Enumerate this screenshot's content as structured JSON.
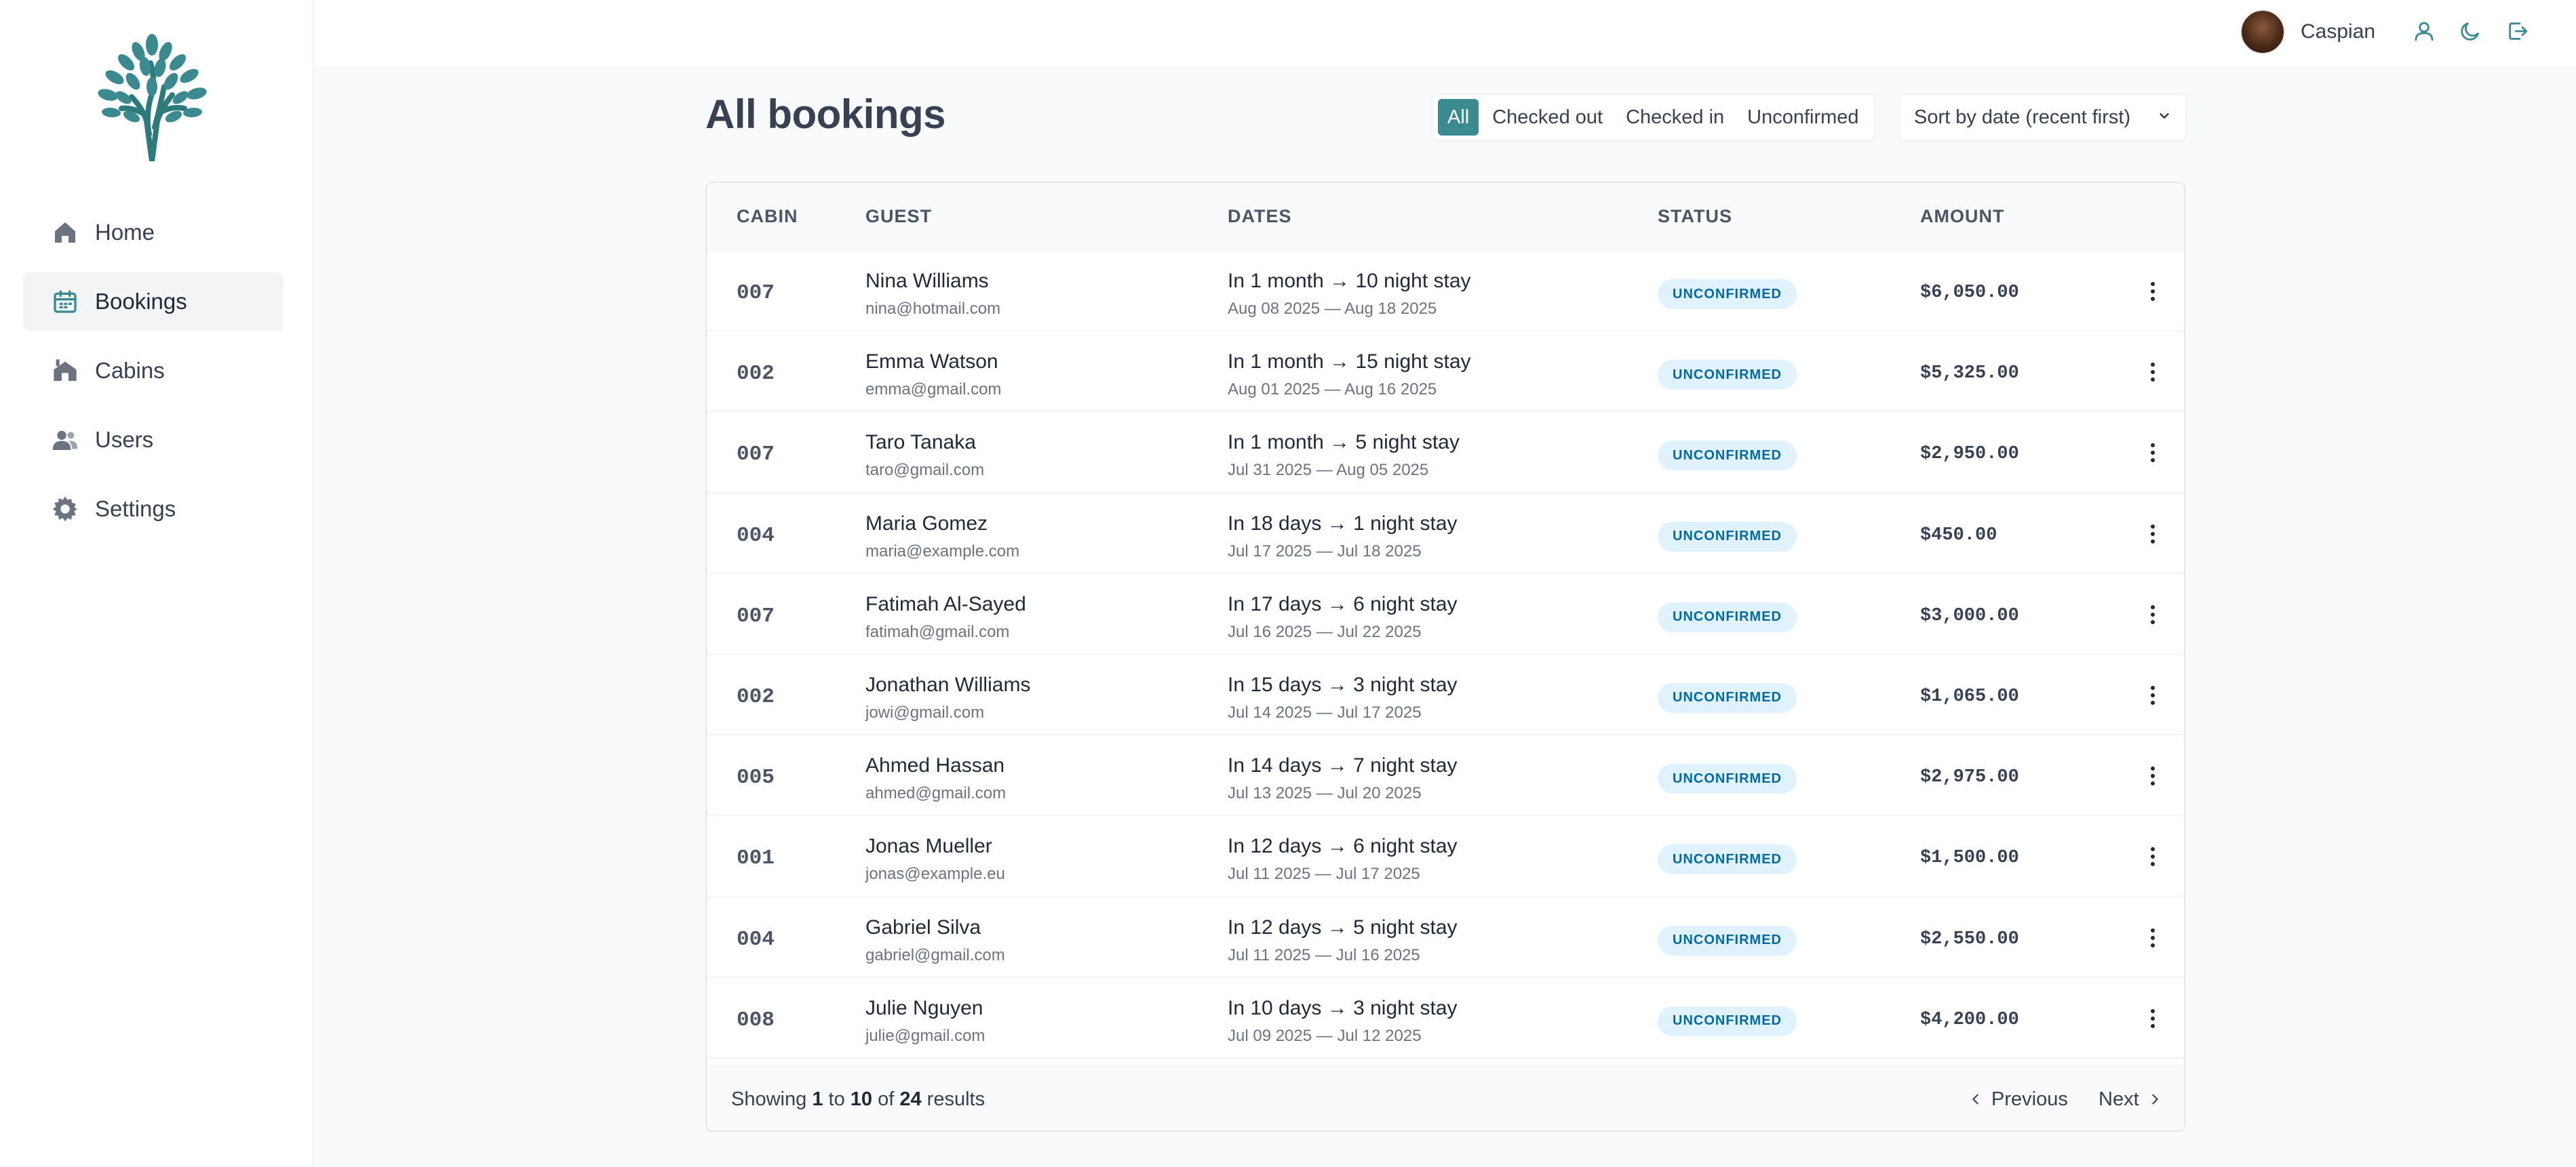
{
  "colors": {
    "brand": "#3b8a8f",
    "badge_bg": "#e0f2fe",
    "badge_text": "#0369a1"
  },
  "sidebar": {
    "logo": "tree-logo",
    "items": [
      {
        "label": "Home",
        "icon": "home-icon",
        "active": false
      },
      {
        "label": "Bookings",
        "icon": "calendar-icon",
        "active": true
      },
      {
        "label": "Cabins",
        "icon": "cabin-icon",
        "active": false
      },
      {
        "label": "Users",
        "icon": "users-icon",
        "active": false
      },
      {
        "label": "Settings",
        "icon": "gear-icon",
        "active": false
      }
    ]
  },
  "header": {
    "user_name": "Caspian",
    "buttons": [
      "user-icon",
      "moon-icon",
      "logout-icon"
    ]
  },
  "page": {
    "title": "All bookings"
  },
  "filter": {
    "options": [
      "All",
      "Checked out",
      "Checked in",
      "Unconfirmed"
    ],
    "selected": "All"
  },
  "sort": {
    "selected": "Sort by date (recent first)"
  },
  "table": {
    "columns": [
      "CABIN",
      "GUEST",
      "DATES",
      "STATUS",
      "AMOUNT"
    ],
    "rows": [
      {
        "cabin": "007",
        "guest": "Nina Williams",
        "email": "nina@hotmail.com",
        "stay": "In 1 month → 10 night stay",
        "range": "Aug 08 2025 — Aug 18 2025",
        "status": "UNCONFIRMED",
        "amount": "$6,050.00"
      },
      {
        "cabin": "002",
        "guest": "Emma Watson",
        "email": "emma@gmail.com",
        "stay": "In 1 month → 15 night stay",
        "range": "Aug 01 2025 — Aug 16 2025",
        "status": "UNCONFIRMED",
        "amount": "$5,325.00"
      },
      {
        "cabin": "007",
        "guest": "Taro Tanaka",
        "email": "taro@gmail.com",
        "stay": "In 1 month → 5 night stay",
        "range": "Jul 31 2025 — Aug 05 2025",
        "status": "UNCONFIRMED",
        "amount": "$2,950.00"
      },
      {
        "cabin": "004",
        "guest": "Maria Gomez",
        "email": "maria@example.com",
        "stay": "In 18 days → 1 night stay",
        "range": "Jul 17 2025 — Jul 18 2025",
        "status": "UNCONFIRMED",
        "amount": "$450.00"
      },
      {
        "cabin": "007",
        "guest": "Fatimah Al-Sayed",
        "email": "fatimah@gmail.com",
        "stay": "In 17 days → 6 night stay",
        "range": "Jul 16 2025 — Jul 22 2025",
        "status": "UNCONFIRMED",
        "amount": "$3,000.00"
      },
      {
        "cabin": "002",
        "guest": "Jonathan Williams",
        "email": "jowi@gmail.com",
        "stay": "In 15 days → 3 night stay",
        "range": "Jul 14 2025 — Jul 17 2025",
        "status": "UNCONFIRMED",
        "amount": "$1,065.00"
      },
      {
        "cabin": "005",
        "guest": "Ahmed Hassan",
        "email": "ahmed@gmail.com",
        "stay": "In 14 days → 7 night stay",
        "range": "Jul 13 2025 — Jul 20 2025",
        "status": "UNCONFIRMED",
        "amount": "$2,975.00"
      },
      {
        "cabin": "001",
        "guest": "Jonas Mueller",
        "email": "jonas@example.eu",
        "stay": "In 12 days → 6 night stay",
        "range": "Jul 11 2025 — Jul 17 2025",
        "status": "UNCONFIRMED",
        "amount": "$1,500.00"
      },
      {
        "cabin": "004",
        "guest": "Gabriel Silva",
        "email": "gabriel@gmail.com",
        "stay": "In 12 days → 5 night stay",
        "range": "Jul 11 2025 — Jul 16 2025",
        "status": "UNCONFIRMED",
        "amount": "$2,550.00"
      },
      {
        "cabin": "008",
        "guest": "Julie Nguyen",
        "email": "julie@gmail.com",
        "stay": "In 10 days → 3 night stay",
        "range": "Jul 09 2025 — Jul 12 2025",
        "status": "UNCONFIRMED",
        "amount": "$4,200.00"
      }
    ]
  },
  "pagination": {
    "showing_prefix": "Showing",
    "from": "1",
    "to_word": "to",
    "to": "10",
    "of_word": "of",
    "total": "24",
    "suffix": "results",
    "previous_label": "Previous",
    "next_label": "Next"
  }
}
